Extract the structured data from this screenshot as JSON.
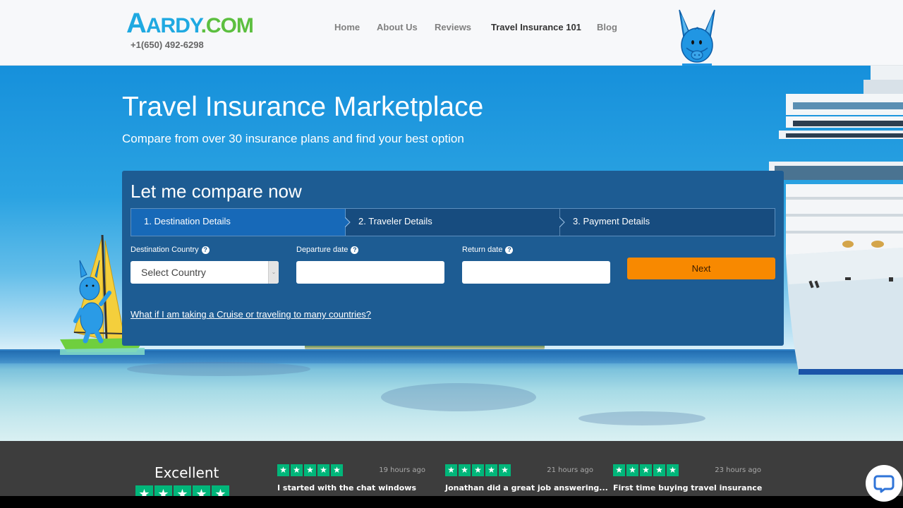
{
  "header": {
    "logo": {
      "first": "A",
      "mid": "ARDY",
      "suffix": ".COM"
    },
    "phone": "+1(650) 492-6298",
    "nav": [
      {
        "label": "Home",
        "active": false
      },
      {
        "label": "About Us",
        "active": false
      },
      {
        "label": "Reviews",
        "active": false
      },
      {
        "label": "Travel Insurance 101",
        "active": true
      },
      {
        "label": "Blog",
        "active": false
      }
    ],
    "mascot_icon": "aardvark-mascot"
  },
  "hero": {
    "title": "Travel Insurance Marketplace",
    "subtitle": "Compare from over 30 insurance plans and find your best option"
  },
  "form": {
    "title": "Let me compare now",
    "steps": [
      {
        "label": "1. Destination Details",
        "active": true
      },
      {
        "label": "2. Traveler Details",
        "active": false
      },
      {
        "label": "3. Payment Details",
        "active": false
      }
    ],
    "fields": {
      "destination": {
        "label": "Destination Country",
        "value": "Select Country",
        "help_icon": "?"
      },
      "departure": {
        "label": "Departure date",
        "value": "",
        "help_icon": "?"
      },
      "return": {
        "label": "Return date",
        "value": "",
        "help_icon": "?"
      }
    },
    "next_label": "Next",
    "cruise_link": "What if I am taking a Cruise or traveling to many countries?"
  },
  "reviews": {
    "summary": "Excellent",
    "summary_rating": 5,
    "star_glyph": "★",
    "items": [
      {
        "time": "19 hours ago",
        "title": "I started with the chat windows",
        "rating": 5
      },
      {
        "time": "21 hours ago",
        "title": "Jonathan did a great job answering...",
        "rating": 5
      },
      {
        "time": "23 hours ago",
        "title": "First time buying travel insurance",
        "rating": 5
      }
    ]
  },
  "colors": {
    "brand_blue": "#1fa9e1",
    "brand_green": "#5cbf3f",
    "panel": "#1d5c93",
    "active_step": "#1769b8",
    "next_button": "#f88900",
    "trustpilot_green": "#00b67a"
  }
}
